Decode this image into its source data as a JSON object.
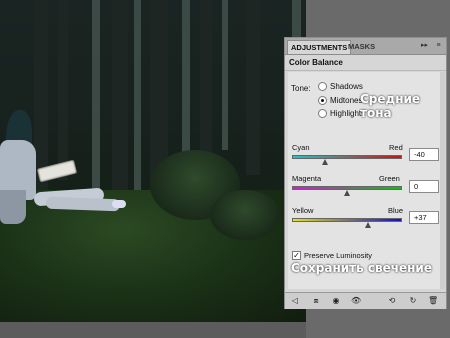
{
  "tabs": [
    {
      "label": "ADJUSTMENTS",
      "active": true
    },
    {
      "label": "MASKS",
      "active": false
    }
  ],
  "panel": {
    "title": "Color Balance",
    "tone": {
      "label": "Tone:",
      "options": [
        "Shadows",
        "Midtones",
        "Highlights"
      ],
      "selected": "Midtones"
    },
    "sliders": [
      {
        "left": "Cyan",
        "right": "Red",
        "value": "-40",
        "gradient_left": "#20c4c8",
        "gradient_right": "#d01010"
      },
      {
        "left": "Magenta",
        "right": "Green",
        "value": "0",
        "gradient_left": "#d01cd0",
        "gradient_right": "#10c010"
      },
      {
        "left": "Yellow",
        "right": "Blue",
        "value": "+37",
        "gradient_left": "#e8e010",
        "gradient_right": "#1010c8"
      }
    ],
    "preserve_luminosity": {
      "label": "Preserve Luminosity",
      "checked": true
    }
  },
  "captions": {
    "midtones_ru": "Средние тона",
    "preserve_ru": "Сохранить свечение"
  },
  "icons": {
    "back": "back-arrow-icon",
    "view": "view-mode-icon",
    "clip": "clip-to-layer-icon",
    "eye": "visibility-icon",
    "prev_state": "previous-state-icon",
    "reset": "reset-icon",
    "delete": "delete-icon"
  }
}
